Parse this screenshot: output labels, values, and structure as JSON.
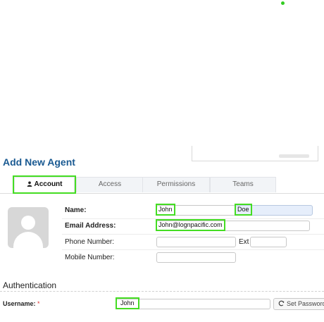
{
  "page": {
    "title": "Add New Agent"
  },
  "tabs": [
    {
      "label": "Account",
      "active": true,
      "icon": "user-icon"
    },
    {
      "label": "Access",
      "active": false
    },
    {
      "label": "Permissions",
      "active": false
    },
    {
      "label": "Teams",
      "active": false
    }
  ],
  "account": {
    "name_label": "Name:",
    "first_name": "John",
    "last_name": "Doe",
    "email_label": "Email Address:",
    "email": "John@lognpacific.com",
    "phone_label": "Phone Number:",
    "phone": "",
    "ext_label": "Ext",
    "ext": "",
    "mobile_label": "Mobile Number:",
    "mobile": ""
  },
  "authentication": {
    "section_title": "Authentication",
    "username_label": "Username:",
    "required_marker": "*",
    "username": "John",
    "set_password_label": "Set Password"
  },
  "colors": {
    "title": "#1a5a92",
    "highlight": "#44dd22",
    "required": "#dd3333"
  }
}
